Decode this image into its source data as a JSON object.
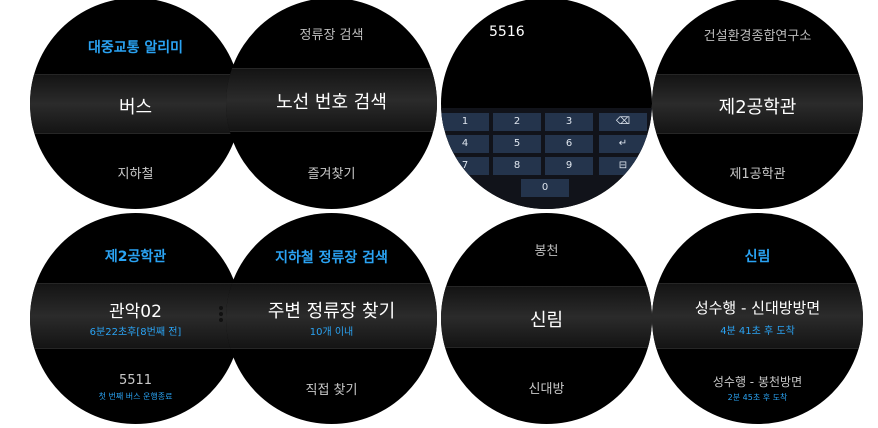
{
  "watch1": {
    "title": "대중교통 알리미",
    "selected": "버스",
    "next": "지하철"
  },
  "watch2": {
    "prev": "정류장 검색",
    "selected": "노선 번호 검색",
    "next": "즐겨찾기"
  },
  "watch3": {
    "input_value": "5516",
    "keys": [
      "1",
      "2",
      "3",
      "4",
      "5",
      "6",
      "7",
      "8",
      "9",
      "0"
    ],
    "backspace_glyph": "⌫",
    "enter_glyph": "↵",
    "hide_glyph": "⊟"
  },
  "watch4": {
    "prev": "건설환경종합연구소",
    "selected": "제2공학관",
    "next": "제1공학관"
  },
  "watch5": {
    "title": "제2공학관",
    "selected": "관악02",
    "selected_eta": "6분22초후[8번째 전]",
    "next": "5511",
    "next_status": "첫 번째 버스 운행종료"
  },
  "watch6": {
    "title": "지하철 정류장 검색",
    "selected": "주변 정류장 찾기",
    "selected_sub": "10개 이내",
    "next": "직접 찾기"
  },
  "watch7": {
    "prev": "봉천",
    "selected": "신림",
    "next": "신대방"
  },
  "watch8": {
    "title": "신림",
    "selected": "성수행 - 신대방방면",
    "selected_eta": "4분 41초 후 도착",
    "next": "성수행 - 봉천방면",
    "next_eta": "2분 45초 후 도착"
  },
  "colors": {
    "accent_blue": "#2aa3f3",
    "key_blue": "#24344c",
    "watch_bg": "#000000"
  }
}
